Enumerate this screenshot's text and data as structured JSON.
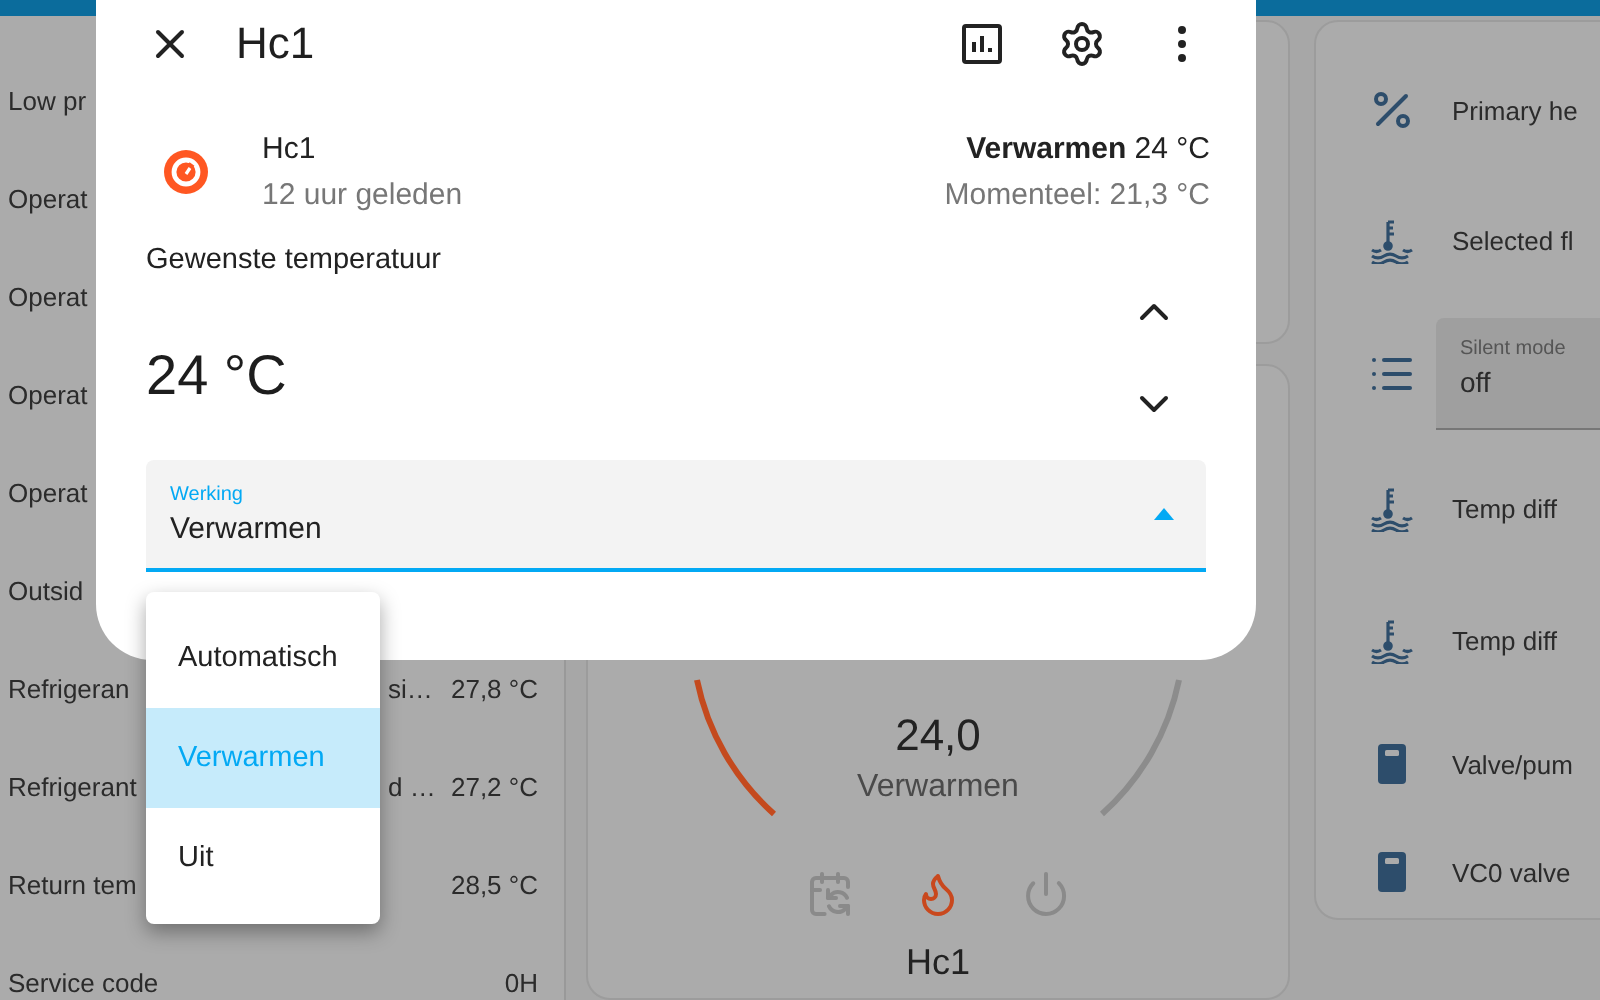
{
  "dialog": {
    "title": "Hc1",
    "entity": {
      "name": "Hc1",
      "updated": "12 uur geleden",
      "state": "**Verwarmen** 24 °C",
      "current": "Momenteel: 21,3 °C"
    },
    "target": {
      "label": "Gewenste temperatuur",
      "value": "24 °C"
    },
    "select": {
      "label": "Werking",
      "value": "Verwarmen",
      "expanded": true
    },
    "menu": [
      {
        "label": "Automatisch",
        "selected": false
      },
      {
        "label": "Verwarmen",
        "selected": true
      },
      {
        "label": "Uit",
        "selected": false
      }
    ]
  },
  "left_rows": [
    {
      "label": "Low pr"
    },
    {
      "label": "Operat"
    },
    {
      "label": "Operat"
    },
    {
      "label": "Operat"
    },
    {
      "label": "Operat"
    },
    {
      "label": "Outsid"
    },
    {
      "label": "Refrigeran",
      "tail": "si…",
      "value": "27,8 °C"
    },
    {
      "label": "Refrigerant",
      "tail": "d …",
      "value": "27,2 °C"
    },
    {
      "label": "Return tem",
      "value": "28,5 °C"
    },
    {
      "label": "Service code",
      "value": "0H"
    }
  ],
  "thermostat": {
    "value": "24,0",
    "mode": "Verwarmen",
    "name": "Hc1",
    "modes": [
      {
        "kind": "schedule",
        "selected": false
      },
      {
        "kind": "heat",
        "selected": true
      },
      {
        "kind": "off",
        "selected": false
      }
    ]
  },
  "right_rows": [
    {
      "kind": "percent",
      "label": "Primary he"
    },
    {
      "kind": "water-temp",
      "label": "Selected fl"
    },
    {
      "kind": "select",
      "select_label": "Silent mode",
      "value": "off"
    },
    {
      "kind": "water-temp",
      "label": "Temp diff"
    },
    {
      "kind": "water-temp",
      "label": "Temp diff"
    },
    {
      "kind": "valve",
      "label": "Valve/pum"
    },
    {
      "kind": "valve",
      "label": "VC0 valve"
    }
  ]
}
